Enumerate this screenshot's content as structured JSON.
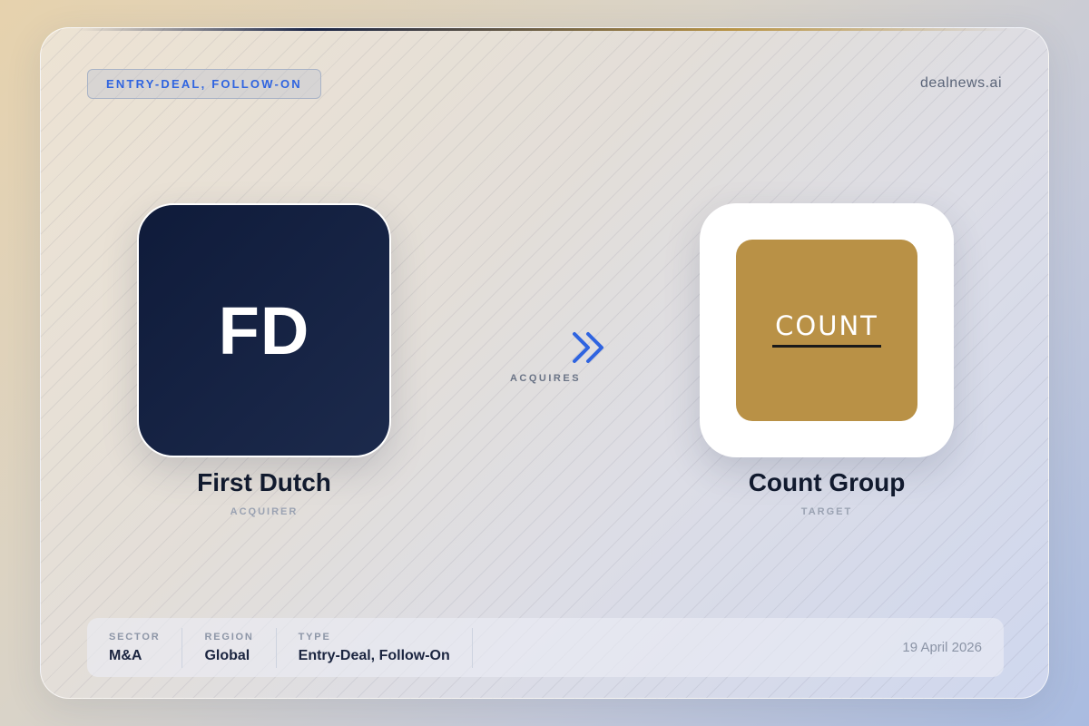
{
  "header": {
    "badge": "ENTRY-DEAL, FOLLOW-ON",
    "brand": "dealnews.ai"
  },
  "acquirer": {
    "logo_text": "FD",
    "name": "First Dutch",
    "role": "ACQUIRER"
  },
  "target": {
    "logo_text": "COUNT",
    "name": "Count Group",
    "role": "TARGET"
  },
  "relation": {
    "label": "ACQUIRES"
  },
  "footer": {
    "sector": {
      "label": "SECTOR",
      "value": "M&A"
    },
    "region": {
      "label": "REGION",
      "value": "Global"
    },
    "type": {
      "label": "TYPE",
      "value": "Entry-Deal, Follow-On"
    },
    "date": "19 April 2026"
  },
  "colors": {
    "accent": "#2f64e0",
    "acquirer_logo_bg": "#0f1b3a",
    "target_logo_bg": "#b99146"
  },
  "icons": {
    "relation": "double-chevron-arrow-icon"
  }
}
